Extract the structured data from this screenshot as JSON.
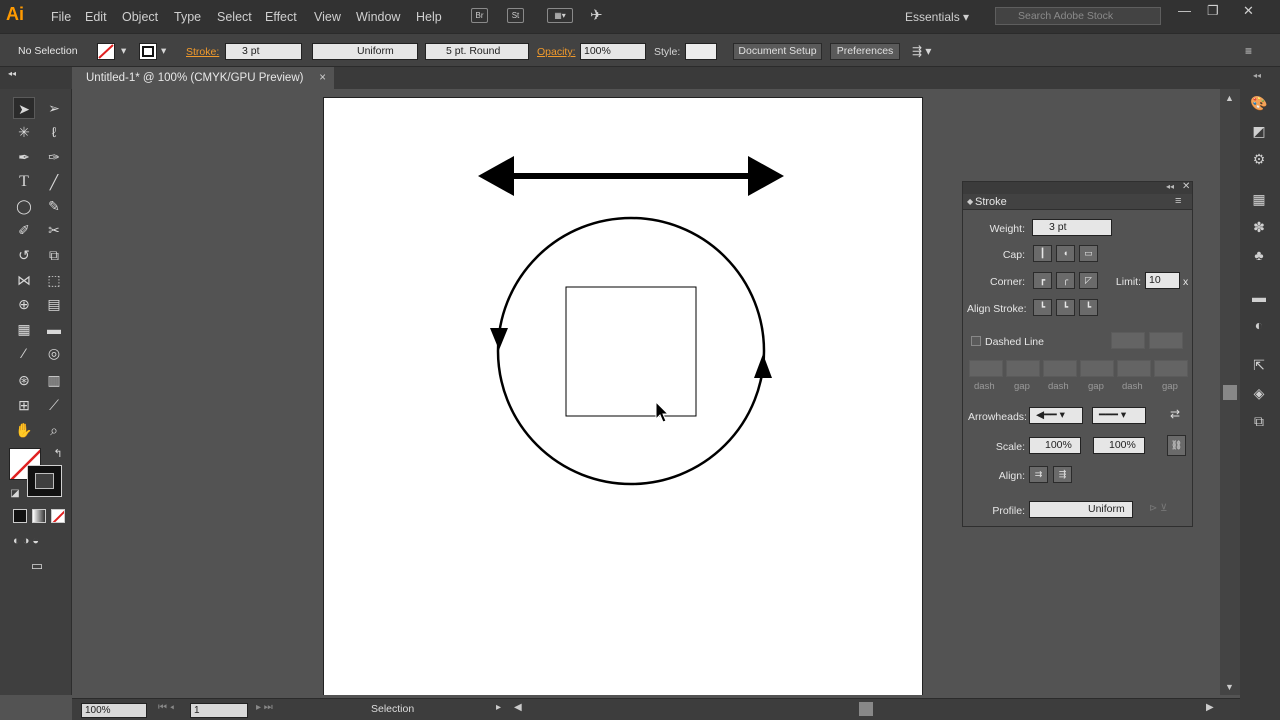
{
  "app": {
    "logo": "Ai"
  },
  "menu": [
    "File",
    "Edit",
    "Object",
    "Type",
    "Select",
    "Effect",
    "View",
    "Window",
    "Help"
  ],
  "menu_buttons": [
    "Br",
    "St"
  ],
  "workspace": "Essentials",
  "search_placeholder": "Search Adobe Stock",
  "control": {
    "selection": "No Selection",
    "stroke_label": "Stroke:",
    "stroke_weight": "3 pt",
    "profile": "Uniform",
    "brush": "5 pt. Round",
    "opacity_label": "Opacity:",
    "opacity": "100%",
    "style_label": "Style:",
    "document_setup": "Document Setup",
    "preferences": "Preferences"
  },
  "document_tab": {
    "title": "Untitled-1* @ 100% (CMYK/GPU Preview)",
    "close": "×"
  },
  "stroke_panel": {
    "title": "Stroke",
    "weight_label": "Weight:",
    "weight": "3 pt",
    "cap_label": "Cap:",
    "corner_label": "Corner:",
    "limit_label": "Limit:",
    "limit": "10",
    "limit_x": "x",
    "align_stroke_label": "Align Stroke:",
    "dashed_line_label": "Dashed Line",
    "dash_labels": [
      "dash",
      "gap",
      "dash",
      "gap",
      "dash",
      "gap"
    ],
    "arrowheads_label": "Arrowheads:",
    "scale_label": "Scale:",
    "scale_start": "100%",
    "scale_end": "100%",
    "align_label": "Align:",
    "profile_label": "Profile:",
    "profile": "Uniform"
  },
  "status": {
    "zoom": "100%",
    "artboard": "1",
    "tool": "Selection"
  },
  "colors": {
    "accent": "#ff9a00",
    "chrome": "#323232",
    "panel": "#535353",
    "artboard": "#ffffff"
  }
}
